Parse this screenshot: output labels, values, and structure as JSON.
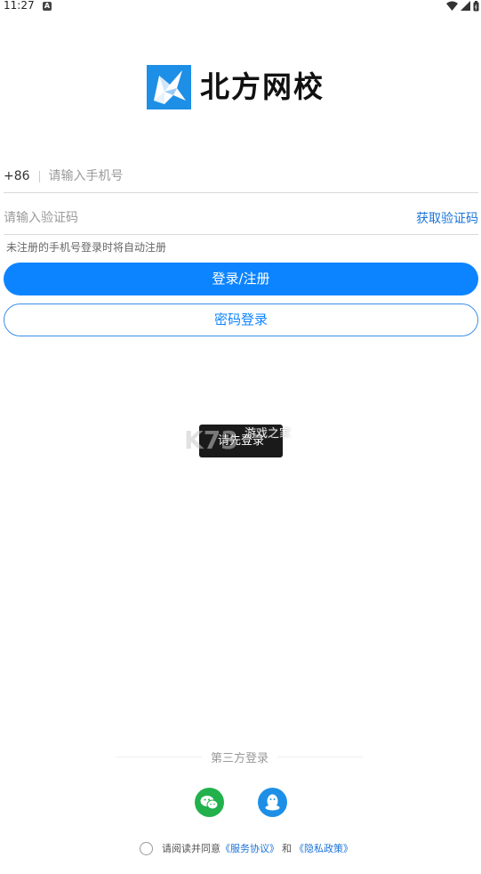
{
  "status_bar": {
    "time": "11:27",
    "notification_icon": "a-badge-icon",
    "right_icons": [
      "wifi-icon",
      "signal-icon",
      "battery-icon"
    ]
  },
  "logo": {
    "text": "北方网校",
    "brand_color": "#1d8fe6"
  },
  "phone": {
    "country_code": "+86",
    "placeholder": "请输入手机号",
    "value": ""
  },
  "code": {
    "placeholder": "请输入验证码",
    "value": "",
    "get_code_label": "获取验证码"
  },
  "hint": "未注册的手机号登录时将自动注册",
  "login_button_label": "登录/注册",
  "password_login_label": "密码登录",
  "toast": "请先登录",
  "watermark_text": "游戏之家",
  "third_party": {
    "title": "第三方登录",
    "wechat_icon": "wechat-icon",
    "qq_icon": "qq-icon"
  },
  "agreement": {
    "prefix": "请阅读并同意",
    "service_link": "《服务协议》",
    "conjunction": "和",
    "privacy_link": "《隐私政策》"
  },
  "colors": {
    "accent": "#0d84ff",
    "link": "#1a73d9",
    "wechat": "#22b14c",
    "qq": "#1d8fe6"
  }
}
